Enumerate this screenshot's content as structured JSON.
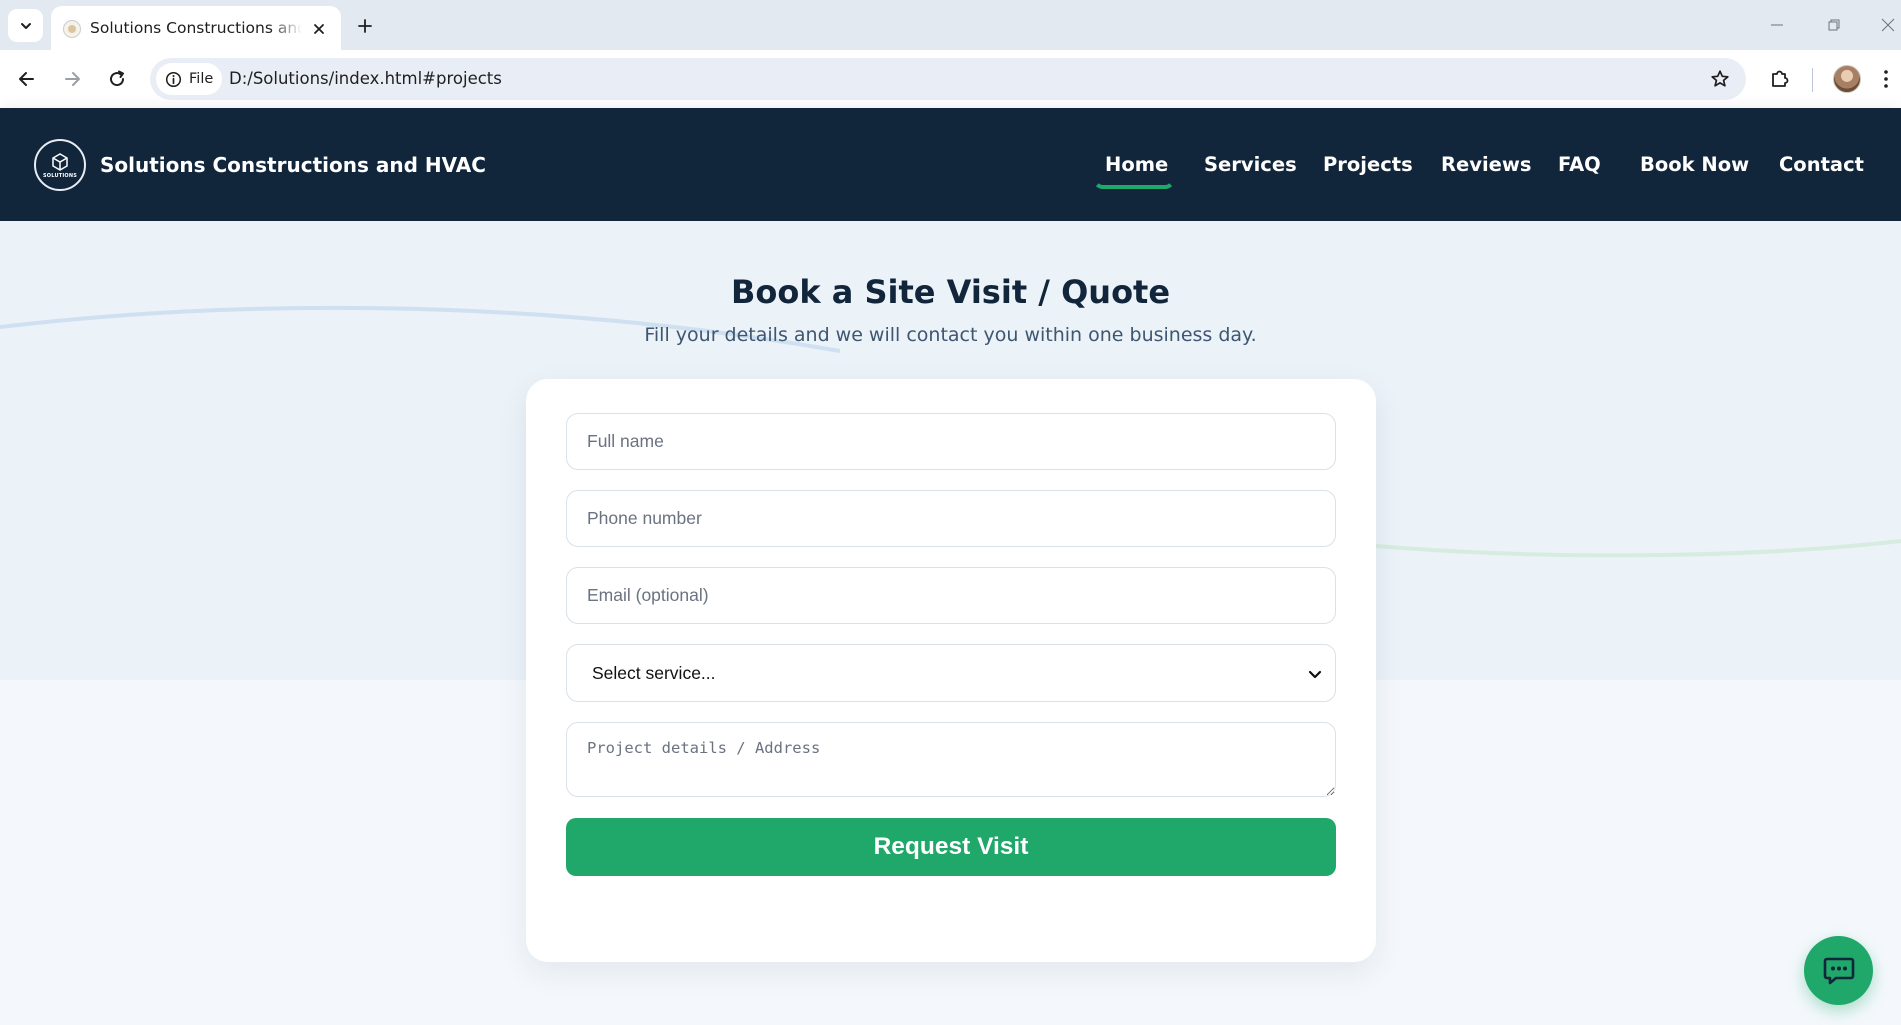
{
  "browser": {
    "tab_title": "Solutions Constructions and HVAC",
    "site_chip": "File",
    "url": "D:/Solutions/index.html#projects"
  },
  "site": {
    "logo_text": "SOLUTIONS",
    "brand": "Solutions Constructions and HVAC",
    "nav": {
      "home": "Home",
      "services": "Services",
      "projects": "Projects",
      "reviews": "Reviews",
      "faq": "FAQ",
      "book_now": "Book Now",
      "contact": "Contact"
    },
    "active_nav": "Home",
    "accent_color": "#1fa86a",
    "header_color": "#11253b"
  },
  "booking": {
    "title": "Book a Site Visit / Quote",
    "subtitle": "Fill your details and we will contact you within one business day.",
    "full_name_placeholder": "Full name",
    "phone_placeholder": "Phone number",
    "email_placeholder": "Email (optional)",
    "service_selected": "Select service...",
    "details_placeholder": "Project details / Address",
    "submit_label": "Request Visit"
  },
  "icons": {
    "tab_list": "chevron-down-icon",
    "close_tab": "close-icon",
    "new_tab": "plus-icon",
    "back": "arrow-left-icon",
    "forward": "arrow-right-icon",
    "reload": "reload-icon",
    "site_info": "info-icon",
    "bookmark": "star-icon",
    "extensions": "puzzle-icon",
    "menu": "kebab-menu-icon",
    "chat": "chat-bubble-icon"
  }
}
